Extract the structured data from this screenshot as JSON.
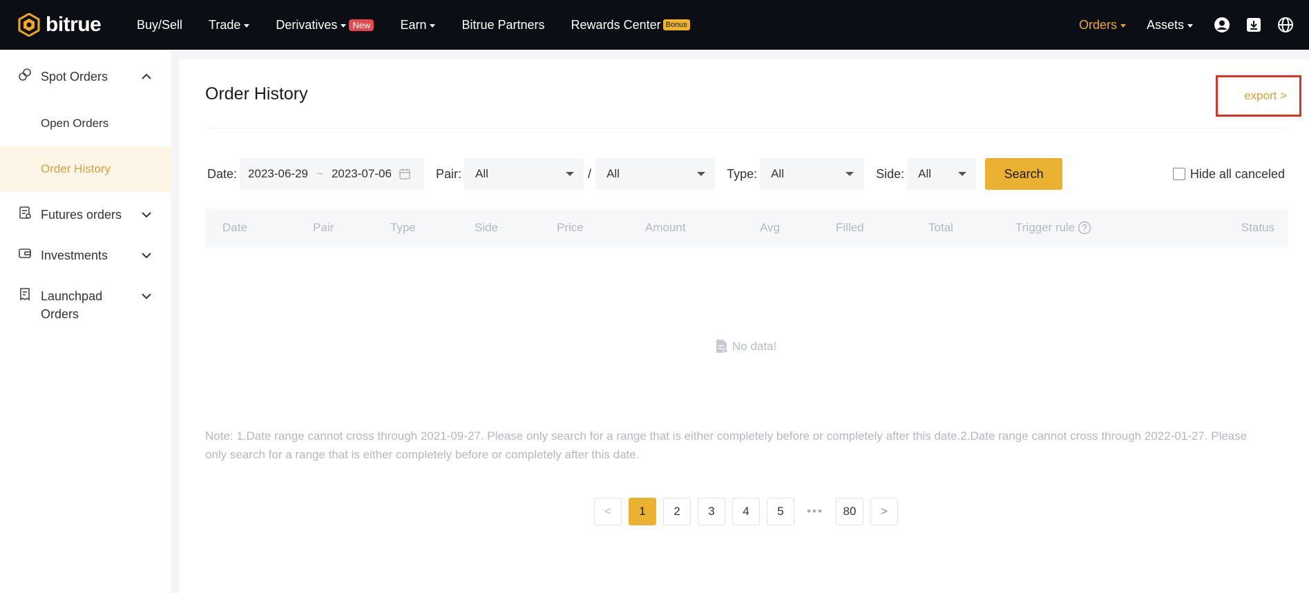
{
  "header": {
    "brand": "bitrue",
    "nav": [
      {
        "label": "Buy/Sell"
      },
      {
        "label": "Trade"
      },
      {
        "label": "Derivatives",
        "badge": "New"
      },
      {
        "label": "Earn"
      },
      {
        "label": "Bitrue Partners"
      },
      {
        "label": "Rewards Center",
        "badge": "Bonus"
      }
    ],
    "orders_label": "Orders",
    "assets_label": "Assets",
    "accent": "#f0a924"
  },
  "sidebar": {
    "spot_orders": "Spot Orders",
    "open_orders": "Open Orders",
    "order_history": "Order History",
    "futures_orders": "Futures orders",
    "investments": "Investments",
    "launchpad_line1": "Launchpad",
    "launchpad_line2": "Orders"
  },
  "main": {
    "title": "Order History",
    "export_label": "export >",
    "filters": {
      "date_label": "Date:",
      "date_from": "2023-06-29",
      "date_sep": "~",
      "date_to": "2023-07-06",
      "pair_label": "Pair:",
      "pair_base": "All",
      "pair_slash": "/",
      "pair_quote": "All",
      "type_label": "Type:",
      "type_value": "All",
      "side_label": "Side:",
      "side_value": "All",
      "search_label": "Search",
      "hide_canceled_label": "Hide all canceled"
    },
    "columns": [
      "Date",
      "Pair",
      "Type",
      "Side",
      "Price",
      "Amount",
      "Avg",
      "Filled",
      "Total",
      "Trigger rule",
      "Status"
    ],
    "no_data": "No data!",
    "note_line1": "Note: 1.Date range cannot cross through 2021-09-27. Please only search for a range that is either completely before or completely after this date.2.Date range cannot cross through 2022-01-27. Please",
    "note_line2": "only search for a range that is either completely before or completely after this date."
  },
  "pagination": {
    "prev": "<",
    "pages": [
      "1",
      "2",
      "3",
      "4",
      "5"
    ],
    "ellipsis": "•••",
    "last": "80",
    "next": ">",
    "current": "1"
  }
}
